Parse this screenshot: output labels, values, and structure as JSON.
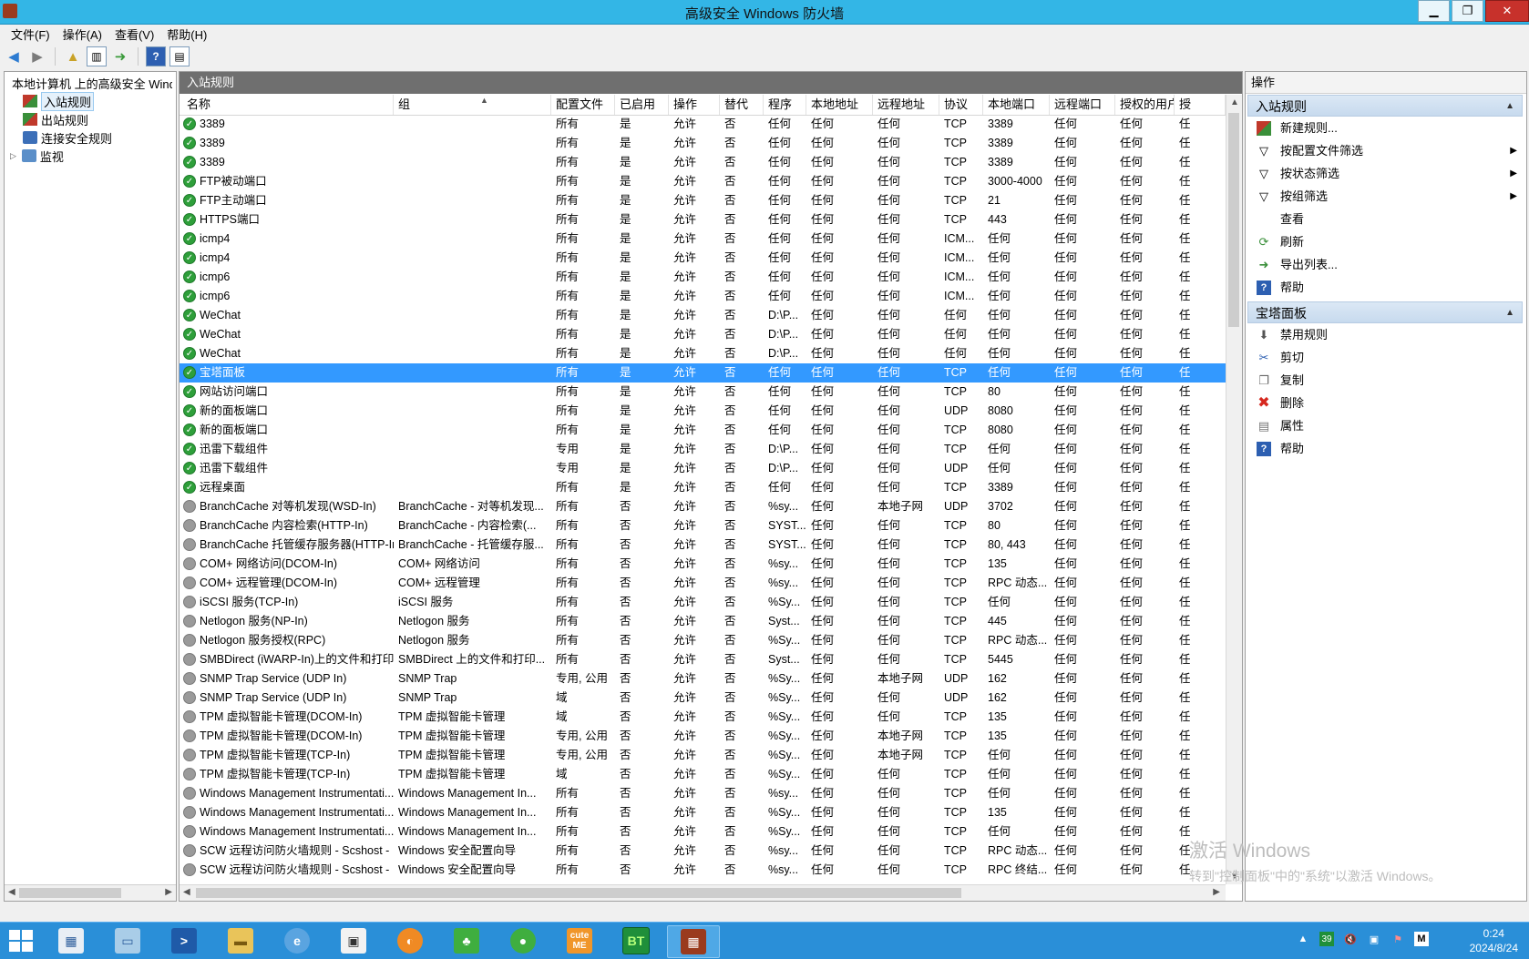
{
  "window": {
    "title": "高级安全 Windows 防火墙",
    "minimize": "▁",
    "restore": "❐",
    "close": "✕"
  },
  "menu": [
    "文件(F)",
    "操作(A)",
    "查看(V)",
    "帮助(H)"
  ],
  "tree": {
    "root": "本地计算机 上的高级安全 Windows 防火墙",
    "items": [
      "入站规则",
      "出站规则",
      "连接安全规则",
      "监视"
    ]
  },
  "center": {
    "header": "入站规则",
    "columns": [
      "名称",
      "组",
      "配置文件",
      "已启用",
      "操作",
      "替代",
      "程序",
      "本地地址",
      "远程地址",
      "协议",
      "本地端口",
      "远程端口",
      "授权的用户",
      "授"
    ],
    "rows": [
      [
        "3389",
        "",
        "所有",
        "是",
        "允许",
        "否",
        "任何",
        "任何",
        "任何",
        "TCP",
        "3389",
        "任何",
        "任何",
        "任"
      ],
      [
        "3389",
        "",
        "所有",
        "是",
        "允许",
        "否",
        "任何",
        "任何",
        "任何",
        "TCP",
        "3389",
        "任何",
        "任何",
        "任"
      ],
      [
        "3389",
        "",
        "所有",
        "是",
        "允许",
        "否",
        "任何",
        "任何",
        "任何",
        "TCP",
        "3389",
        "任何",
        "任何",
        "任"
      ],
      [
        "FTP被动端口",
        "",
        "所有",
        "是",
        "允许",
        "否",
        "任何",
        "任何",
        "任何",
        "TCP",
        "3000-4000",
        "任何",
        "任何",
        "任"
      ],
      [
        "FTP主动端口",
        "",
        "所有",
        "是",
        "允许",
        "否",
        "任何",
        "任何",
        "任何",
        "TCP",
        "21",
        "任何",
        "任何",
        "任"
      ],
      [
        "HTTPS端口",
        "",
        "所有",
        "是",
        "允许",
        "否",
        "任何",
        "任何",
        "任何",
        "TCP",
        "443",
        "任何",
        "任何",
        "任"
      ],
      [
        "icmp4",
        "",
        "所有",
        "是",
        "允许",
        "否",
        "任何",
        "任何",
        "任何",
        "ICM...",
        "任何",
        "任何",
        "任何",
        "任"
      ],
      [
        "icmp4",
        "",
        "所有",
        "是",
        "允许",
        "否",
        "任何",
        "任何",
        "任何",
        "ICM...",
        "任何",
        "任何",
        "任何",
        "任"
      ],
      [
        "icmp6",
        "",
        "所有",
        "是",
        "允许",
        "否",
        "任何",
        "任何",
        "任何",
        "ICM...",
        "任何",
        "任何",
        "任何",
        "任"
      ],
      [
        "icmp6",
        "",
        "所有",
        "是",
        "允许",
        "否",
        "任何",
        "任何",
        "任何",
        "ICM...",
        "任何",
        "任何",
        "任何",
        "任"
      ],
      [
        "WeChat",
        "",
        "所有",
        "是",
        "允许",
        "否",
        "D:\\P...",
        "任何",
        "任何",
        "任何",
        "任何",
        "任何",
        "任何",
        "任"
      ],
      [
        "WeChat",
        "",
        "所有",
        "是",
        "允许",
        "否",
        "D:\\P...",
        "任何",
        "任何",
        "任何",
        "任何",
        "任何",
        "任何",
        "任"
      ],
      [
        "WeChat",
        "",
        "所有",
        "是",
        "允许",
        "否",
        "D:\\P...",
        "任何",
        "任何",
        "任何",
        "任何",
        "任何",
        "任何",
        "任"
      ],
      [
        "宝塔面板",
        "",
        "所有",
        "是",
        "允许",
        "否",
        "任何",
        "任何",
        "任何",
        "TCP",
        "任何",
        "任何",
        "任何",
        "任"
      ],
      [
        "网站访问端口",
        "",
        "所有",
        "是",
        "允许",
        "否",
        "任何",
        "任何",
        "任何",
        "TCP",
        "80",
        "任何",
        "任何",
        "任"
      ],
      [
        "新的面板端口",
        "",
        "所有",
        "是",
        "允许",
        "否",
        "任何",
        "任何",
        "任何",
        "UDP",
        "8080",
        "任何",
        "任何",
        "任"
      ],
      [
        "新的面板端口",
        "",
        "所有",
        "是",
        "允许",
        "否",
        "任何",
        "任何",
        "任何",
        "TCP",
        "8080",
        "任何",
        "任何",
        "任"
      ],
      [
        "迅雷下载组件",
        "",
        "专用",
        "是",
        "允许",
        "否",
        "D:\\P...",
        "任何",
        "任何",
        "TCP",
        "任何",
        "任何",
        "任何",
        "任"
      ],
      [
        "迅雷下载组件",
        "",
        "专用",
        "是",
        "允许",
        "否",
        "D:\\P...",
        "任何",
        "任何",
        "UDP",
        "任何",
        "任何",
        "任何",
        "任"
      ],
      [
        "远程桌面",
        "",
        "所有",
        "是",
        "允许",
        "否",
        "任何",
        "任何",
        "任何",
        "TCP",
        "3389",
        "任何",
        "任何",
        "任"
      ],
      [
        "BranchCache 对等机发现(WSD-In)",
        "BranchCache - 对等机发现...",
        "所有",
        "否",
        "允许",
        "否",
        "%sy...",
        "任何",
        "本地子网",
        "UDP",
        "3702",
        "任何",
        "任何",
        "任"
      ],
      [
        "BranchCache 内容检索(HTTP-In)",
        "BranchCache - 内容检索(...",
        "所有",
        "否",
        "允许",
        "否",
        "SYST...",
        "任何",
        "任何",
        "TCP",
        "80",
        "任何",
        "任何",
        "任"
      ],
      [
        "BranchCache 托管缓存服务器(HTTP-In)",
        "BranchCache - 托管缓存服...",
        "所有",
        "否",
        "允许",
        "否",
        "SYST...",
        "任何",
        "任何",
        "TCP",
        "80, 443",
        "任何",
        "任何",
        "任"
      ],
      [
        "COM+ 网络访问(DCOM-In)",
        "COM+ 网络访问",
        "所有",
        "否",
        "允许",
        "否",
        "%sy...",
        "任何",
        "任何",
        "TCP",
        "135",
        "任何",
        "任何",
        "任"
      ],
      [
        "COM+ 远程管理(DCOM-In)",
        "COM+ 远程管理",
        "所有",
        "否",
        "允许",
        "否",
        "%sy...",
        "任何",
        "任何",
        "TCP",
        "RPC 动态...",
        "任何",
        "任何",
        "任"
      ],
      [
        "iSCSI 服务(TCP-In)",
        "iSCSI 服务",
        "所有",
        "否",
        "允许",
        "否",
        "%Sy...",
        "任何",
        "任何",
        "TCP",
        "任何",
        "任何",
        "任何",
        "任"
      ],
      [
        "Netlogon 服务(NP-In)",
        "Netlogon 服务",
        "所有",
        "否",
        "允许",
        "否",
        "Syst...",
        "任何",
        "任何",
        "TCP",
        "445",
        "任何",
        "任何",
        "任"
      ],
      [
        "Netlogon 服务授权(RPC)",
        "Netlogon 服务",
        "所有",
        "否",
        "允许",
        "否",
        "%Sy...",
        "任何",
        "任何",
        "TCP",
        "RPC 动态...",
        "任何",
        "任何",
        "任"
      ],
      [
        "SMBDirect (iWARP-In)上的文件和打印...",
        "SMBDirect 上的文件和打印...",
        "所有",
        "否",
        "允许",
        "否",
        "Syst...",
        "任何",
        "任何",
        "TCP",
        "5445",
        "任何",
        "任何",
        "任"
      ],
      [
        "SNMP Trap Service (UDP In)",
        "SNMP Trap",
        "专用, 公用",
        "否",
        "允许",
        "否",
        "%Sy...",
        "任何",
        "本地子网",
        "UDP",
        "162",
        "任何",
        "任何",
        "任"
      ],
      [
        "SNMP Trap Service (UDP In)",
        "SNMP Trap",
        "域",
        "否",
        "允许",
        "否",
        "%Sy...",
        "任何",
        "任何",
        "UDP",
        "162",
        "任何",
        "任何",
        "任"
      ],
      [
        "TPM 虚拟智能卡管理(DCOM-In)",
        "TPM 虚拟智能卡管理",
        "域",
        "否",
        "允许",
        "否",
        "%Sy...",
        "任何",
        "任何",
        "TCP",
        "135",
        "任何",
        "任何",
        "任"
      ],
      [
        "TPM 虚拟智能卡管理(DCOM-In)",
        "TPM 虚拟智能卡管理",
        "专用, 公用",
        "否",
        "允许",
        "否",
        "%Sy...",
        "任何",
        "本地子网",
        "TCP",
        "135",
        "任何",
        "任何",
        "任"
      ],
      [
        "TPM 虚拟智能卡管理(TCP-In)",
        "TPM 虚拟智能卡管理",
        "专用, 公用",
        "否",
        "允许",
        "否",
        "%Sy...",
        "任何",
        "本地子网",
        "TCP",
        "任何",
        "任何",
        "任何",
        "任"
      ],
      [
        "TPM 虚拟智能卡管理(TCP-In)",
        "TPM 虚拟智能卡管理",
        "域",
        "否",
        "允许",
        "否",
        "%Sy...",
        "任何",
        "任何",
        "TCP",
        "任何",
        "任何",
        "任何",
        "任"
      ],
      [
        "Windows Management Instrumentati...",
        "Windows Management In...",
        "所有",
        "否",
        "允许",
        "否",
        "%sy...",
        "任何",
        "任何",
        "TCP",
        "任何",
        "任何",
        "任何",
        "任"
      ],
      [
        "Windows Management Instrumentati...",
        "Windows Management In...",
        "所有",
        "否",
        "允许",
        "否",
        "%Sy...",
        "任何",
        "任何",
        "TCP",
        "135",
        "任何",
        "任何",
        "任"
      ],
      [
        "Windows Management Instrumentati...",
        "Windows Management In...",
        "所有",
        "否",
        "允许",
        "否",
        "%Sy...",
        "任何",
        "任何",
        "TCP",
        "任何",
        "任何",
        "任何",
        "任"
      ],
      [
        "SCW 远程访问防火墙规则 - Scshost - ...",
        "Windows 安全配置向导",
        "所有",
        "否",
        "允许",
        "否",
        "%sy...",
        "任何",
        "任何",
        "TCP",
        "RPC 动态...",
        "任何",
        "任何",
        "任"
      ],
      [
        "SCW 远程访问防火墙规则 - Scshost - ...",
        "Windows 安全配置向导",
        "所有",
        "否",
        "允许",
        "否",
        "%sy...",
        "任何",
        "任何",
        "TCP",
        "RPC 终结...",
        "任何",
        "任何",
        "任"
      ]
    ],
    "selected_row": 13
  },
  "actions": {
    "title": "操作",
    "section1": {
      "title": "入站规则",
      "items": [
        "新建规则...",
        "按配置文件筛选",
        "按状态筛选",
        "按组筛选",
        "查看",
        "刷新",
        "导出列表...",
        "帮助"
      ]
    },
    "section2": {
      "title": "宝塔面板",
      "items": [
        "禁用规则",
        "剪切",
        "复制",
        "删除",
        "属性",
        "帮助"
      ]
    }
  },
  "watermark": {
    "line1": "激活 Windows",
    "line2": "转到\"控制面板\"中的\"系统\"以激活 Windows。"
  },
  "taskbar": {
    "apps": [
      "server-manager",
      "explorer-window",
      "powershell",
      "file-explorer",
      "internet-explorer",
      "window-app",
      "orange-app",
      "clover-app",
      "user-app",
      "cuteftp",
      "baota",
      "firewall"
    ],
    "cute_label": "cute ME",
    "bt_label": "BT",
    "tray_badge": "39",
    "ime": "M",
    "time": "0:24",
    "date": "2024/8/24"
  },
  "colors": {
    "selection": "#3399ff",
    "titlebar": "#33b6e6",
    "taskbar": "#2a8fd8",
    "enabled": "#2e9f3a",
    "disabled": "#9a9a9a"
  }
}
